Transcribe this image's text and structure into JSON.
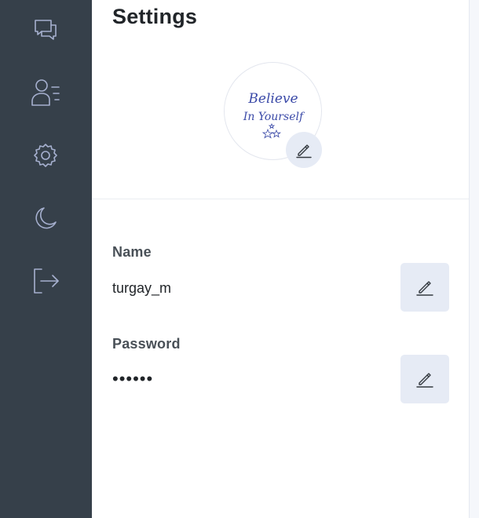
{
  "sidebar": {
    "items": [
      {
        "icon": "chat-icon"
      },
      {
        "icon": "contacts-icon"
      },
      {
        "icon": "gear-icon"
      },
      {
        "icon": "moon-icon"
      },
      {
        "icon": "logout-icon"
      }
    ]
  },
  "header": {
    "title": "Settings"
  },
  "profile": {
    "avatar_text_line1": "Believe",
    "avatar_text_line2": "In Yourself"
  },
  "fields": {
    "name": {
      "label": "Name",
      "value": "turgay_m"
    },
    "password": {
      "label": "Password",
      "value": "••••••"
    }
  },
  "colors": {
    "sidebar_bg": "#36404a",
    "icon": "#a6b0cf",
    "button_bg": "#e6ebf5",
    "avatar_script": "#3b4aa8"
  }
}
